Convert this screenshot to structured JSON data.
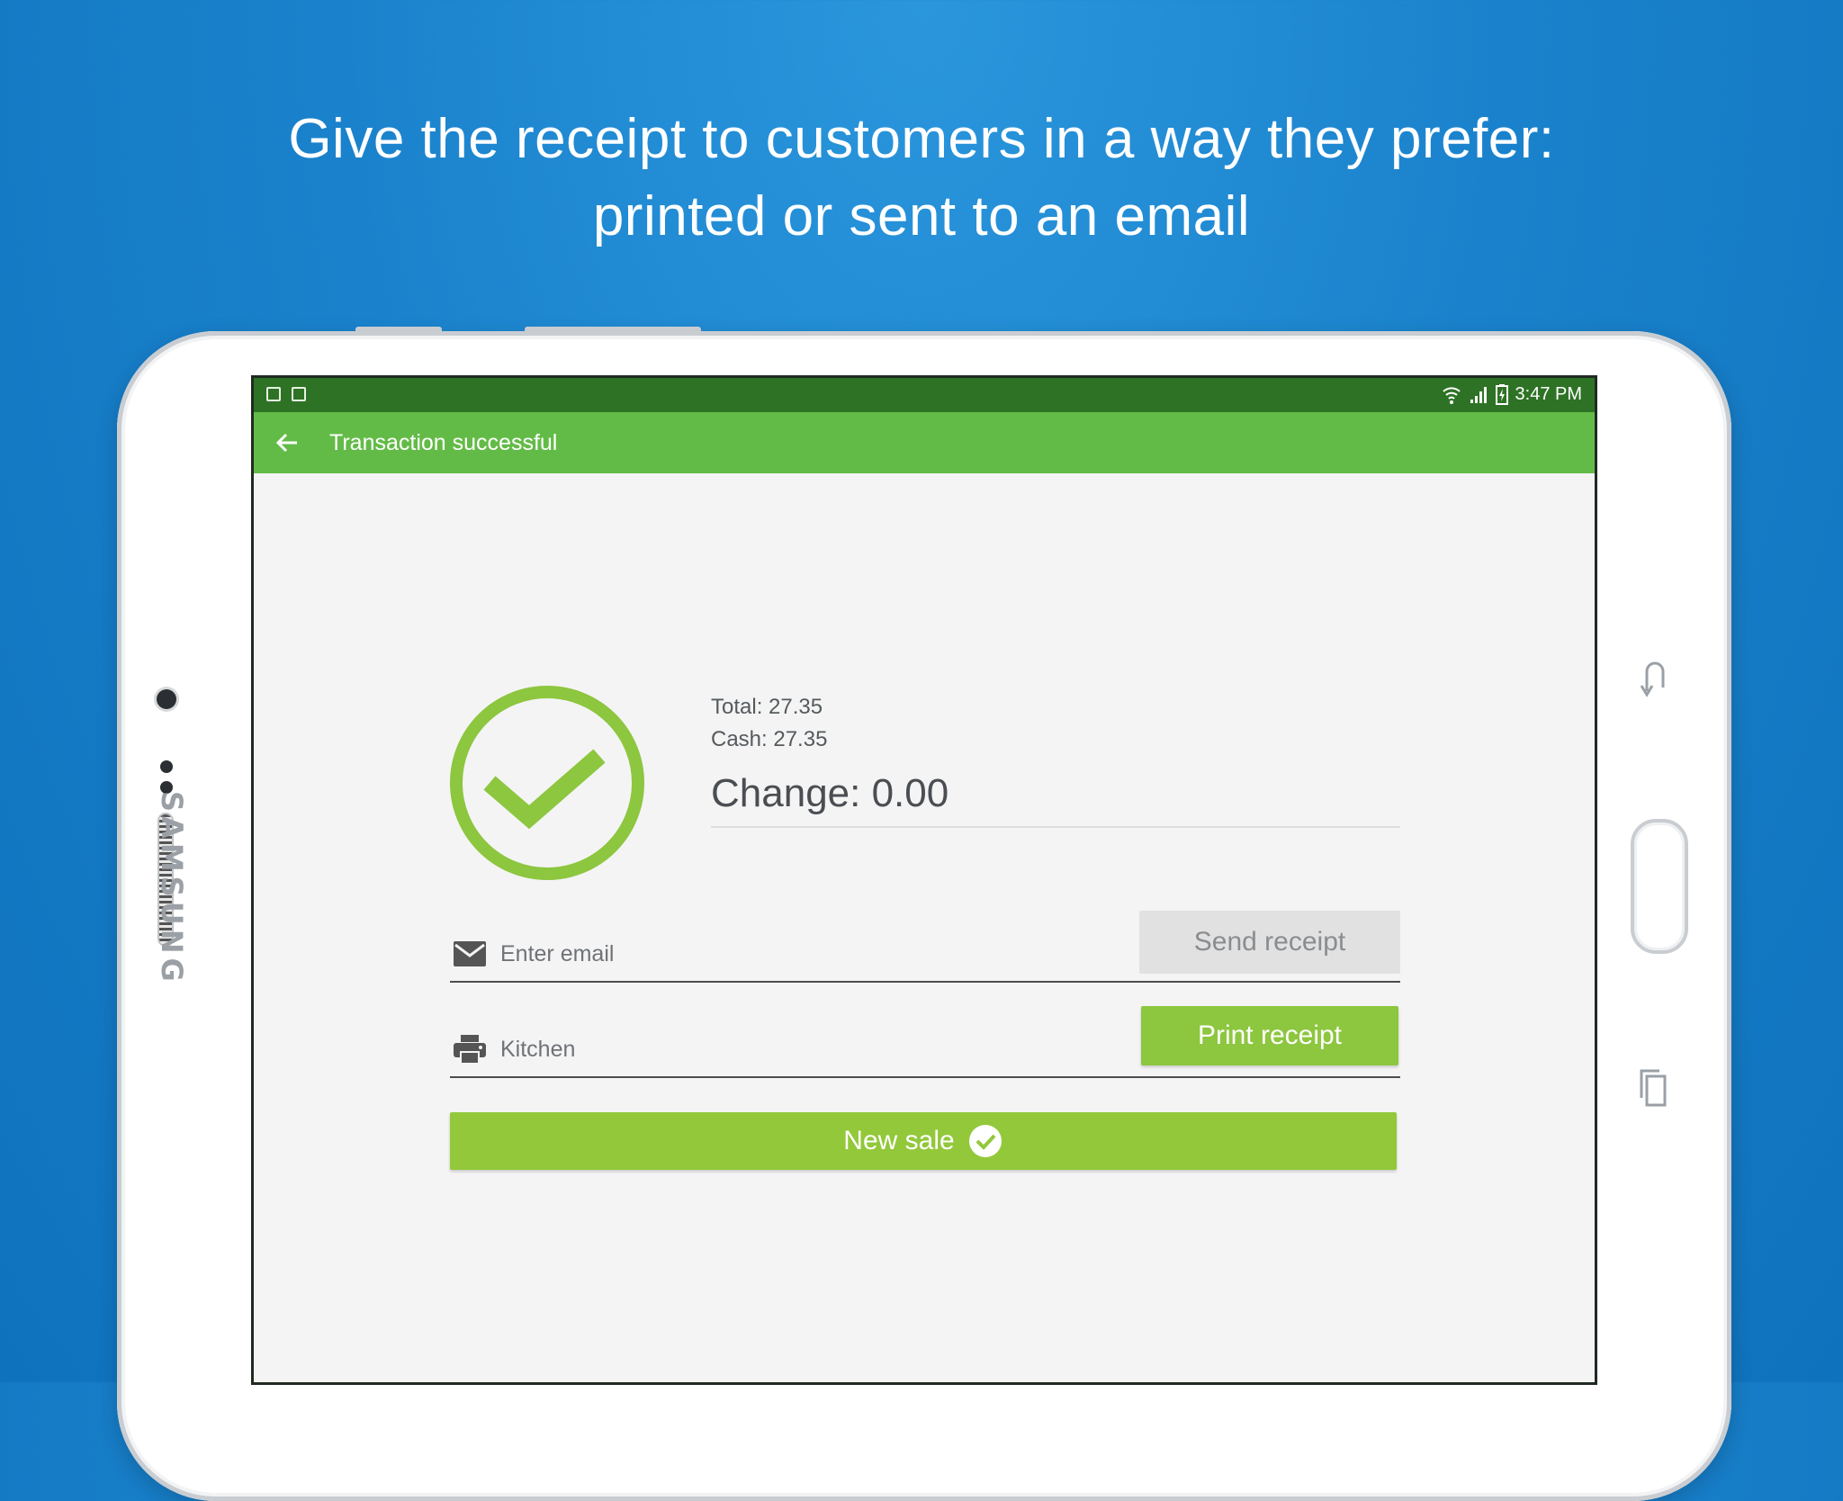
{
  "headline": {
    "line1": "Give the receipt to customers in a way they prefer:",
    "line2": "printed or sent to an email"
  },
  "device": {
    "brand": "SAMSUNG"
  },
  "status_bar": {
    "time": "3:47 PM"
  },
  "toolbar": {
    "title": "Transaction successful"
  },
  "summary": {
    "total": "Total: 27.35",
    "cash": "Cash: 27.35",
    "change": "Change: 0.00"
  },
  "email_row": {
    "placeholder": "Enter email",
    "button": "Send receipt"
  },
  "print_row": {
    "printer": "Kitchen",
    "button": "Print receipt"
  },
  "new_sale": {
    "label": "New sale"
  },
  "colors": {
    "background": "#1a82cc",
    "status_bar": "#2e7325",
    "toolbar": "#63bb47",
    "accent_green": "#8dc63f",
    "success_ring": "#8dc63f"
  }
}
